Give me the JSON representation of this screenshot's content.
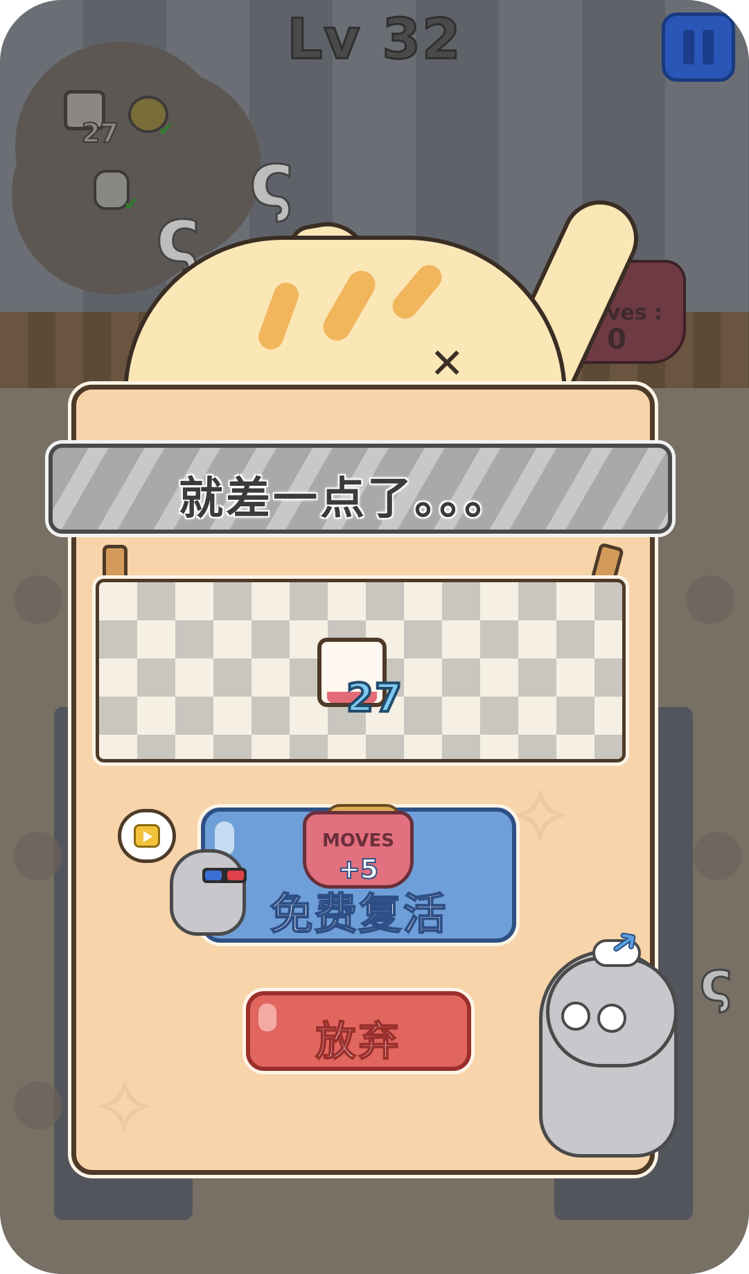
{
  "header": {
    "level_label": "Lv 32",
    "pause_icon": "pause-icon"
  },
  "goals_cloud": {
    "cup_count": "27",
    "bell_done": true,
    "bottle_done": true
  },
  "moves_bowl": {
    "label": "moves :",
    "value": "0"
  },
  "dialog": {
    "title": "就差一点了。。。",
    "remaining_item": {
      "icon": "cup-icon",
      "count": "27"
    },
    "revive_button": {
      "bowl_label": "MOVES",
      "bonus": "+5",
      "label": "免费复活",
      "ad_icon": "video-play-icon"
    },
    "give_up_button": {
      "label": "放弃"
    }
  },
  "colors": {
    "revive_blue": "#6f9fd8",
    "giveup_red": "#e0665f",
    "panel_bg": "#f7d4a9",
    "count_blue": "#7ec9f0"
  }
}
